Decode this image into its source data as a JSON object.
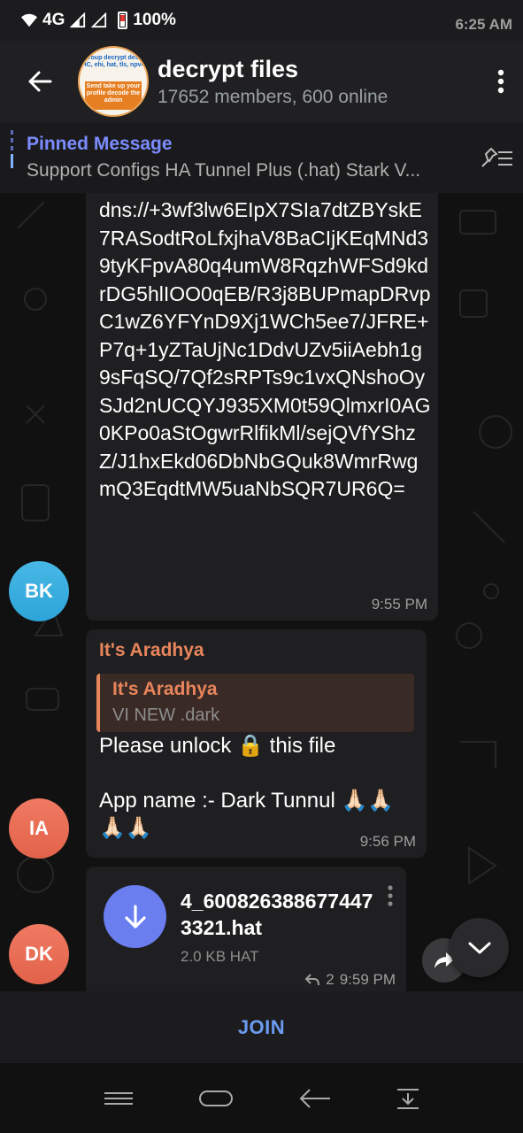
{
  "status_bar": {
    "time": "6:25 AM",
    "network": "4G",
    "battery": "100%"
  },
  "header": {
    "title": "decrypt files",
    "subtitle": "17652 members, 600 online",
    "avatar_top_text": "group decrypt des_ HC, ehi, hat, tls, npv4",
    "avatar_band_text": "Send take up your profile decode the admin"
  },
  "pinned": {
    "title": "Pinned Message",
    "text": "Support Configs  HA Tunnel Plus (.hat) Stark V..."
  },
  "messages": {
    "m1": {
      "avatar": "BK",
      "text": "dns://+3wf3lw6EIpX7SIa7dtZBYskE7RASodtRoLfxjhaV8BaCIjKEqMNd39tyKFpvA80q4umW8RqzhWFSd9kdrDG5hlIOO0qEB/R3j8BUPmapDRvpC1wZ6YFYnD9Xj1WCh5ee7/JFRE+P7q+1yZTaUjNc1DdvUZv5iiAebh1g9sFqSQ/7Qf2sRPTs9c1vxQNshoOySJd2nUCQYJ935XM0t59QlmxrI0AG0KPo0aStOgwrRlfikMl/sejQVfYShzZ/J1hxEkd06DbNbGQuk8WmrRwgmQ3EqdtMW5uaNbSQR7UR6Q=",
      "time": "9:55 PM"
    },
    "m2": {
      "avatar": "IA",
      "sender": "It's Aradhya",
      "reply_name": "It's Aradhya",
      "reply_text": "VI NEW .dark",
      "line1": "Please unlock 🔒 this file",
      "line2": "App name :- Dark Tunnul 🙏🏻🙏🏻",
      "line3": "🙏🏻🙏🏻",
      "time": "9:56 PM"
    },
    "m3": {
      "avatar": "DK",
      "file_name": "4_6008263886774473321.hat",
      "file_size": "2.0 KB HAT",
      "replies": "2",
      "time": "9:59 PM"
    }
  },
  "join_label": "JOIN",
  "colors": {
    "accent": "#6b7ef0",
    "sender": "#e8855c",
    "pinned": "#7c8cff",
    "join": "#6b9bf0"
  }
}
